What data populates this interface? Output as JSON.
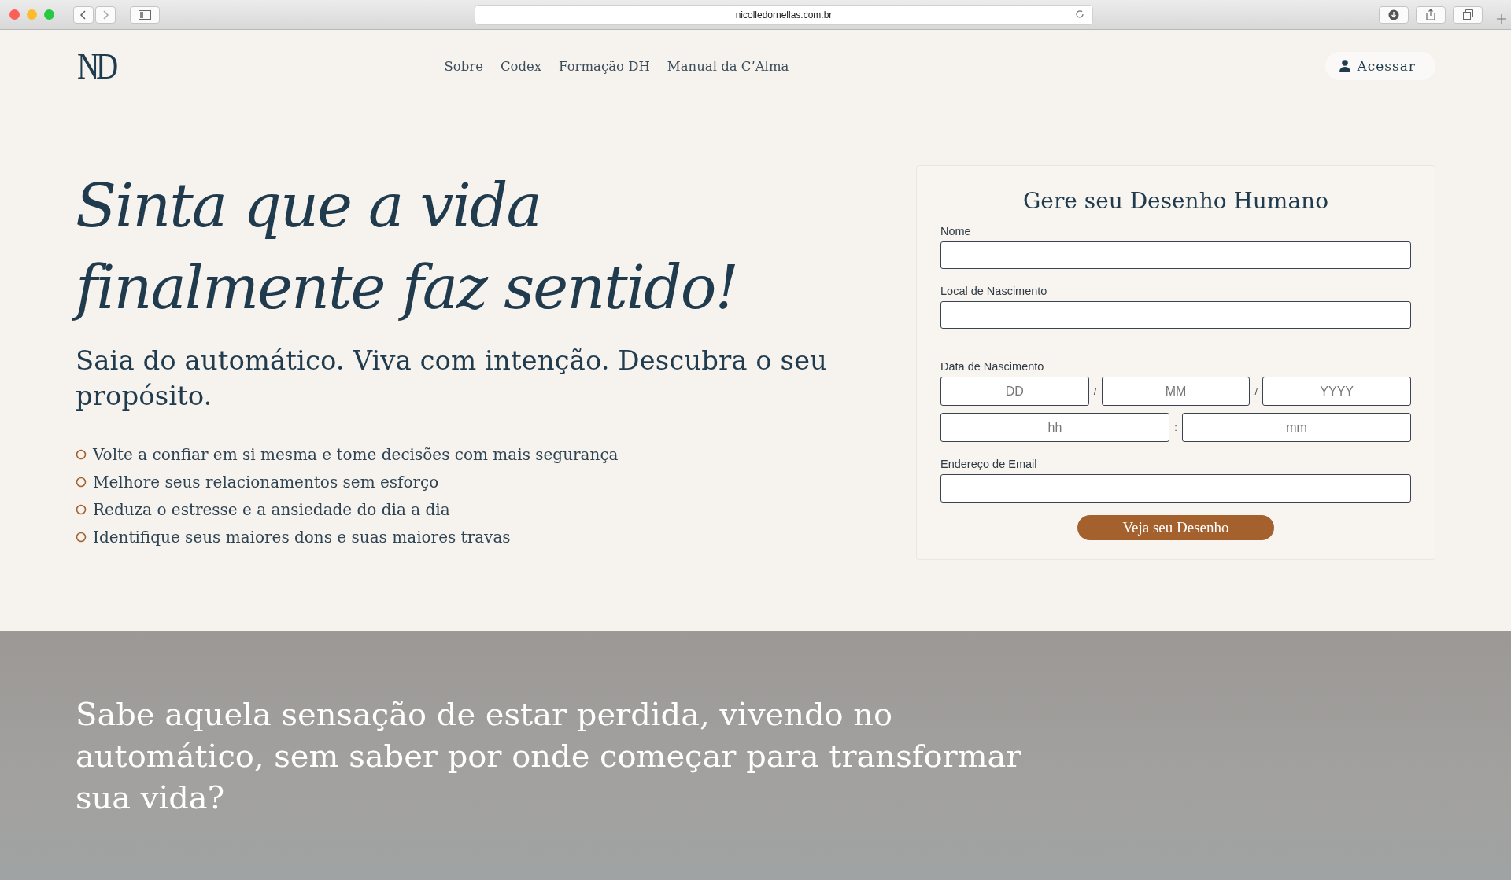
{
  "browser": {
    "url": "nicolledornellas.com.br"
  },
  "header": {
    "logo": "ND",
    "nav": [
      "Sobre",
      "Codex",
      "Formação DH",
      "Manual da C’Alma"
    ],
    "login": "Acessar"
  },
  "hero": {
    "heading_lines": [
      "Sinta que a vida",
      "finalmente faz sentido!"
    ],
    "subheading": "Saia do automático. Viva com intenção. Descubra o seu propósito.",
    "benefits": [
      "Volte a confiar em si mesma e tome decisões com mais segurança",
      "Melhore seus relacionamentos sem esforço",
      "Reduza o estresse e a ansiedade do dia a dia",
      "Identifique seus maiores dons e suas maiores travas"
    ]
  },
  "form": {
    "title": "Gere seu Desenho Humano",
    "name_label": "Nome",
    "place_label": "Local de Nascimento",
    "date_label": "Data de Nascimento",
    "date_fields": [
      {
        "placeholder": "DD"
      },
      {
        "placeholder": "MM"
      },
      {
        "placeholder": "YYYY"
      }
    ],
    "date_separators": [
      "/",
      "/"
    ],
    "time_fields": [
      {
        "placeholder": "hh"
      },
      {
        "placeholder": "mm"
      }
    ],
    "time_separator": ":",
    "email_label": "Endereço de Email",
    "submit": "Veja seu Desenho"
  },
  "section": {
    "heading": "Sabe aquela sensação de estar perdida, vivendo no automático, sem saber por onde começar para transformar sua vida?"
  }
}
